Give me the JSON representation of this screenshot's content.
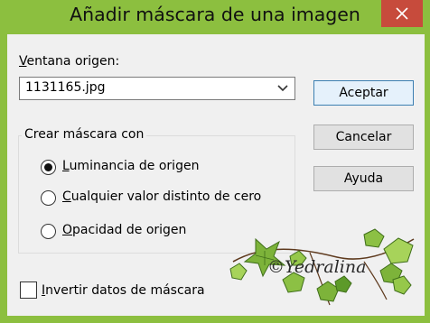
{
  "window": {
    "title": "Añadir máscara de una imagen",
    "title_bar_color": "#8cbf3f",
    "close_button_color": "#c74b3c"
  },
  "source": {
    "label_first": "V",
    "label_rest": "entana origen:",
    "selected_value": "1131165.jpg"
  },
  "buttons": {
    "accept": "Aceptar",
    "cancel": "Cancelar",
    "help": "Ayuda"
  },
  "group": {
    "title": "Crear máscara con",
    "options": [
      {
        "first": "L",
        "rest": "uminancia de origen",
        "checked": true
      },
      {
        "first": "C",
        "rest": "ualquier valor distinto de cero",
        "checked": false
      },
      {
        "first": "O",
        "rest": "pacidad de origen",
        "checked": false
      }
    ]
  },
  "invert": {
    "first": "I",
    "rest": "nvertir datos de máscara",
    "checked": false
  },
  "watermark": {
    "text": "©Yedralina"
  }
}
